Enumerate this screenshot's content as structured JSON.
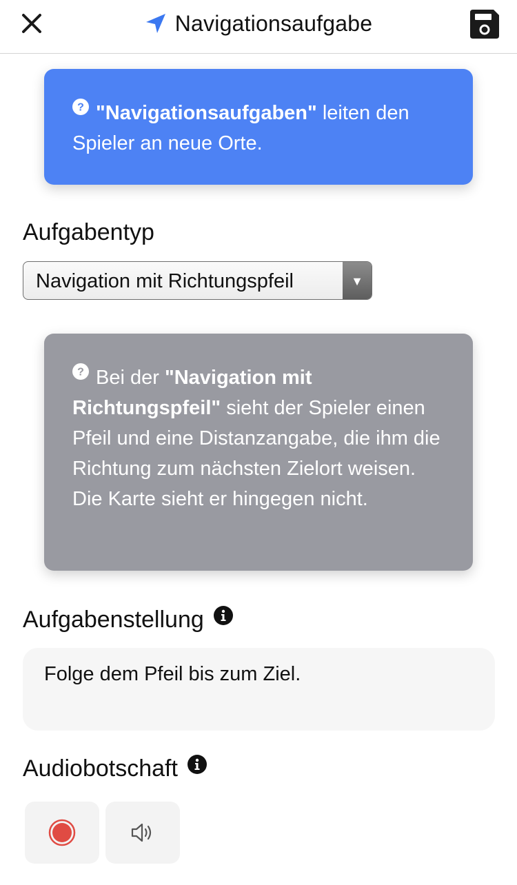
{
  "header": {
    "title": "Navigationsaufgabe",
    "close_icon": "close-icon",
    "nav_icon": "location-arrow-icon",
    "save_icon": "save-floppy-icon"
  },
  "intro_info": {
    "bold": "\"Navigationsaufgaben\"",
    "text": " leiten den Spieler an neue Orte."
  },
  "task_type": {
    "label": "Aufgabentyp",
    "selected": "Navigation mit Richtungspfeil"
  },
  "type_info": {
    "lead": "Bei der ",
    "bold": "\"Navigation mit Richtungspfeil\"",
    "text": " sieht der Spieler einen Pfeil und eine Distanzangabe, die ihm die Richtung zum nächsten Zielort weisen. Die Karte sieht er hingegen nicht."
  },
  "task_statement": {
    "label": "Aufgabenstellung",
    "value": "Folge dem Pfeil bis zum Ziel."
  },
  "audio": {
    "label": "Audiobotschaft",
    "record_icon": "record-icon",
    "play_icon": "speaker-icon"
  },
  "colors": {
    "blue_info": "#4d82f4",
    "gray_info": "#999aa1",
    "record_red": "#e04b43",
    "nav_blue": "#3b78f0"
  }
}
